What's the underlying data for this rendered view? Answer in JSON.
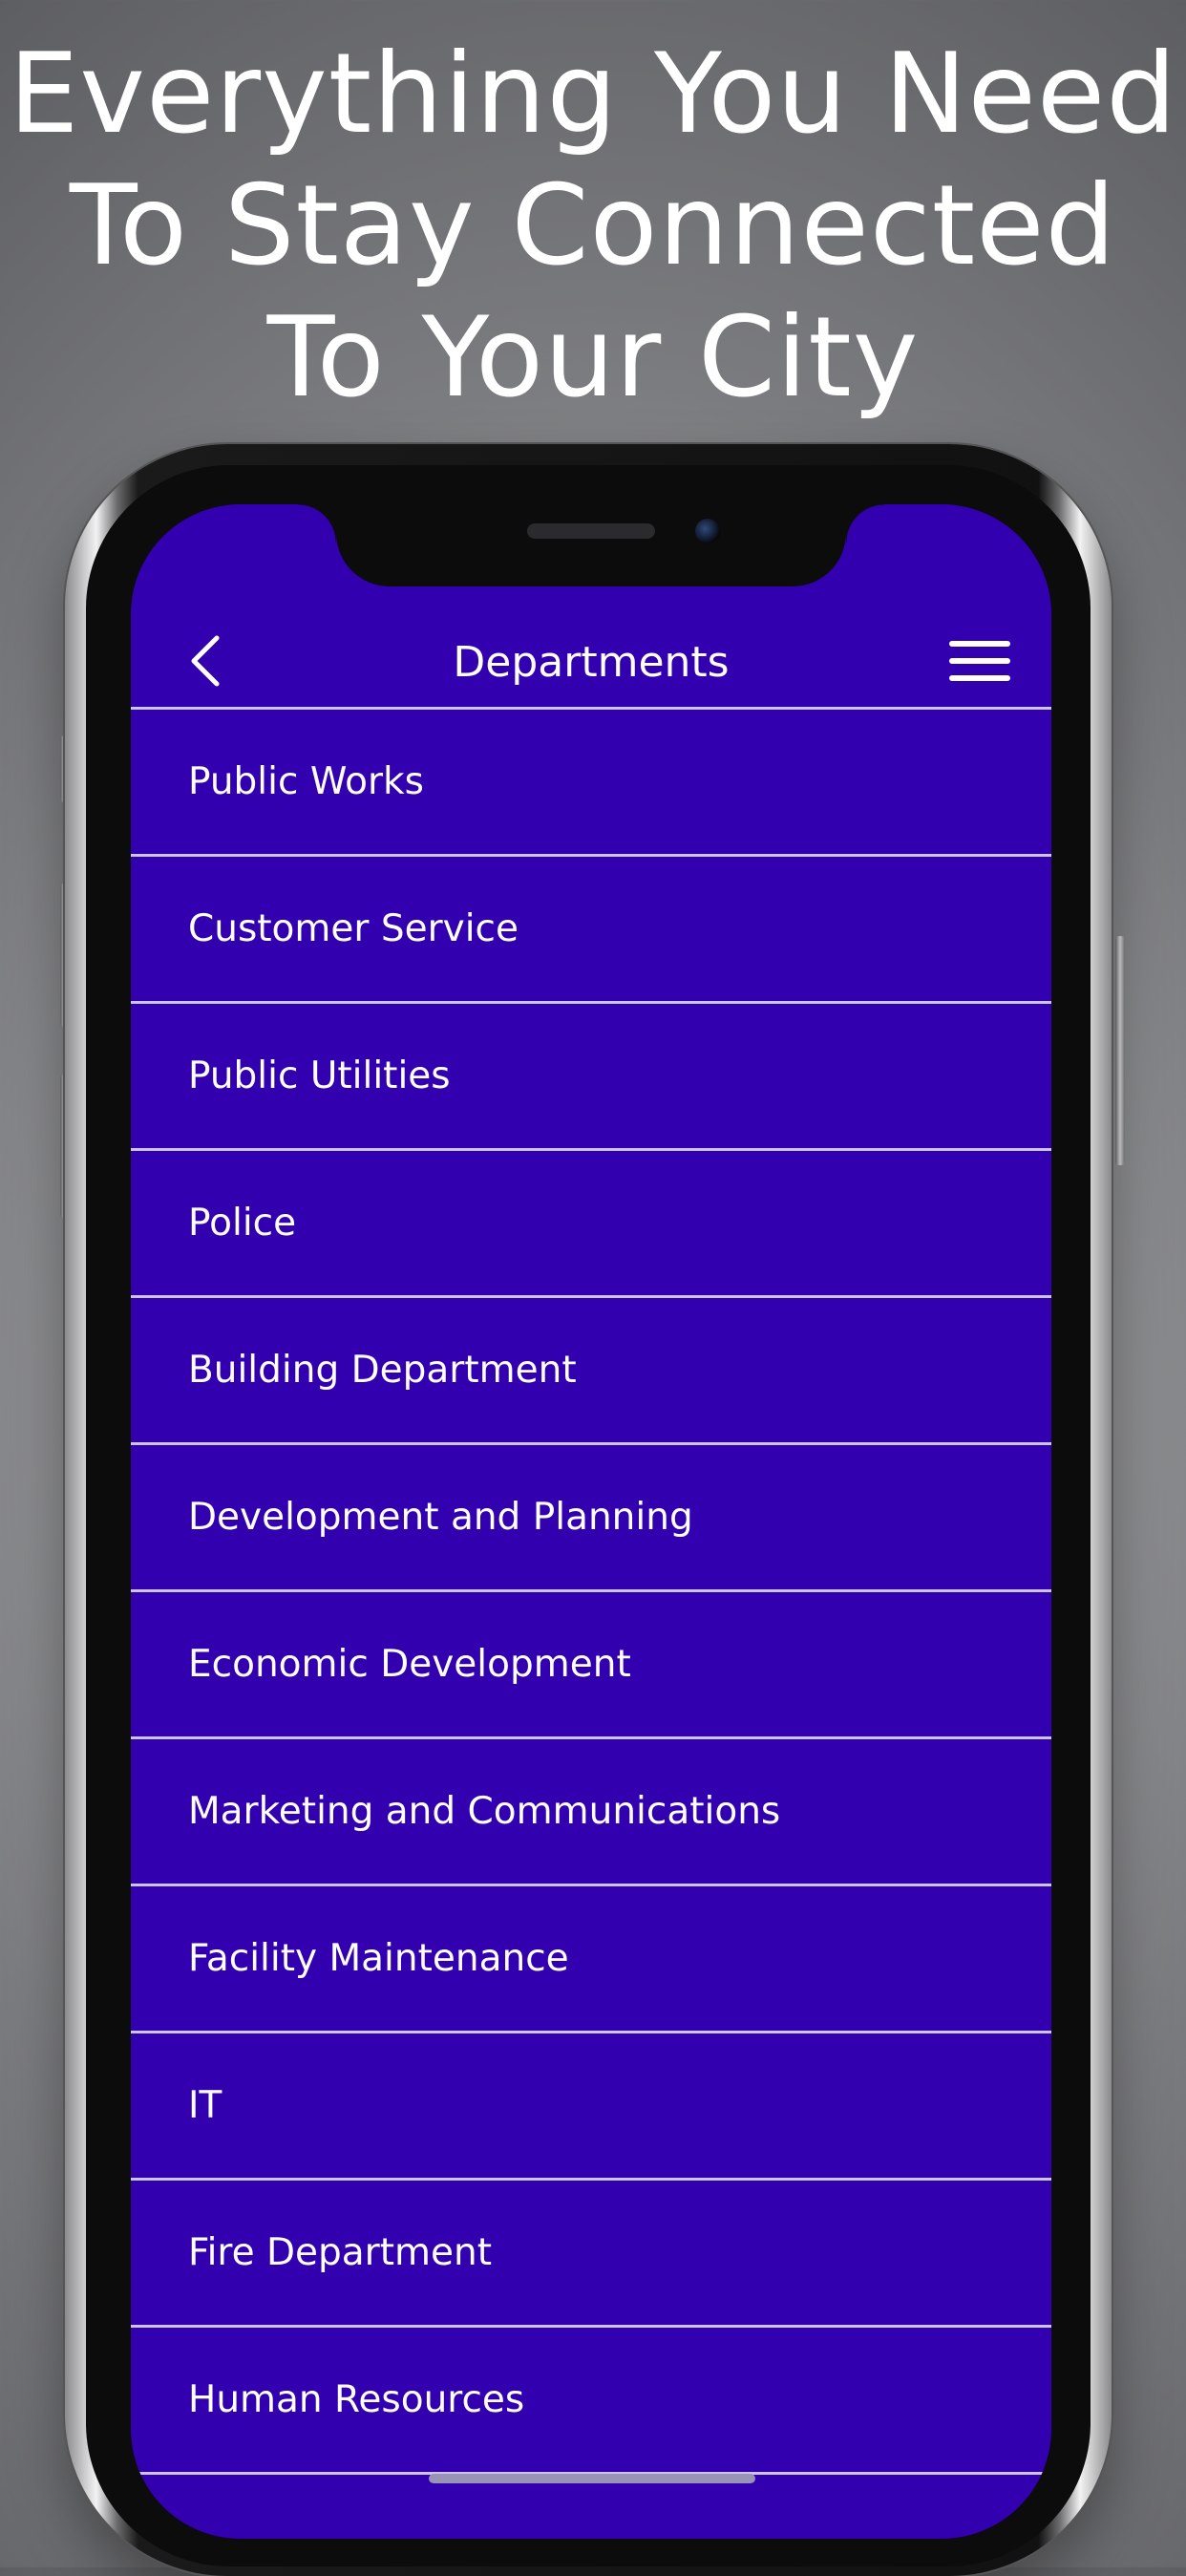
{
  "headline": {
    "line1": "Everything You Need",
    "line2": "To Stay Connected",
    "line3": "To Your City"
  },
  "nav": {
    "title": "Departments",
    "back_icon": "chevron-left-icon",
    "menu_icon": "hamburger-menu-icon"
  },
  "departments": [
    {
      "label": "Public Works"
    },
    {
      "label": "Customer Service"
    },
    {
      "label": "Public Utilities"
    },
    {
      "label": "Police"
    },
    {
      "label": "Building Department"
    },
    {
      "label": "Development and Planning"
    },
    {
      "label": "Economic Development"
    },
    {
      "label": "Marketing and Communications"
    },
    {
      "label": "Facility Maintenance"
    },
    {
      "label": "IT"
    },
    {
      "label": "Fire Department"
    },
    {
      "label": "Human Resources"
    }
  ],
  "colors": {
    "screen_background": "#3300b0",
    "divider": "#cdc3ef",
    "text": "#ffffff"
  }
}
